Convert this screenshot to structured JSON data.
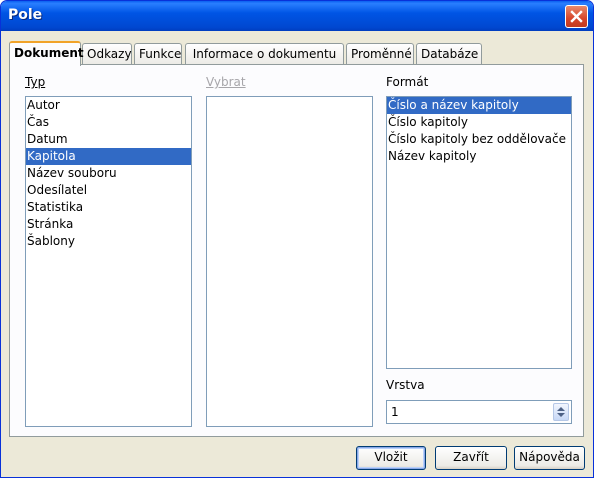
{
  "window": {
    "title": "Pole"
  },
  "tabs": [
    {
      "label": "Dokument"
    },
    {
      "label": "Odkazy"
    },
    {
      "label": "Funkce"
    },
    {
      "label": "Informace o dokumentu"
    },
    {
      "label": "Proměnné"
    },
    {
      "label": "Databáze"
    }
  ],
  "type_section": {
    "label": "Typ",
    "items": [
      "Autor",
      "Čas",
      "Datum",
      "Kapitola",
      "Název souboru",
      "Odesílatel",
      "Statistika",
      "Stránka",
      "Šablony"
    ],
    "selected": "Kapitola"
  },
  "select_section": {
    "label": "Vybrat",
    "items": []
  },
  "format_section": {
    "label": "Formát",
    "items": [
      "Číslo a název kapitoly",
      "Číslo kapitoly",
      "Číslo kapitoly bez oddělovače",
      "Název kapitoly"
    ],
    "selected": "Číslo a název kapitoly"
  },
  "layer": {
    "label": "Vrstva",
    "value": "1"
  },
  "buttons": {
    "insert": "Vložit",
    "close": "Zavřít",
    "help": "Nápověda"
  }
}
